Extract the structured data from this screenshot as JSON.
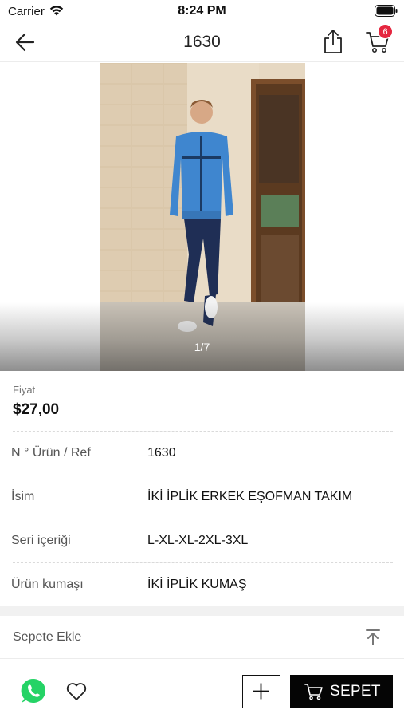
{
  "status_bar": {
    "carrier": "Carrier",
    "time": "8:24 PM"
  },
  "nav": {
    "title": "1630",
    "cart_count": "6"
  },
  "gallery": {
    "indicator": "1/7"
  },
  "price": {
    "label": "Fiyat",
    "value": "$27,00"
  },
  "specs": [
    {
      "label": "N ° Ürün / Ref",
      "value": "1630"
    },
    {
      "label": "İsim",
      "value": "İKİ İPLİK ERKEK EŞOFMAN TAKIM"
    },
    {
      "label": "Seri içeriği",
      "value": "L-XL-XL-2XL-3XL"
    },
    {
      "label": "Ürün kumaşı",
      "value": "İKİ İPLİK KUMAŞ"
    }
  ],
  "add_to_cart": {
    "label": "Sepete Ekle"
  },
  "bottom": {
    "sepet_label": "SEPET"
  },
  "colors": {
    "accent": "#050505",
    "badge": "#e5263f",
    "whatsapp": "#25d366"
  }
}
